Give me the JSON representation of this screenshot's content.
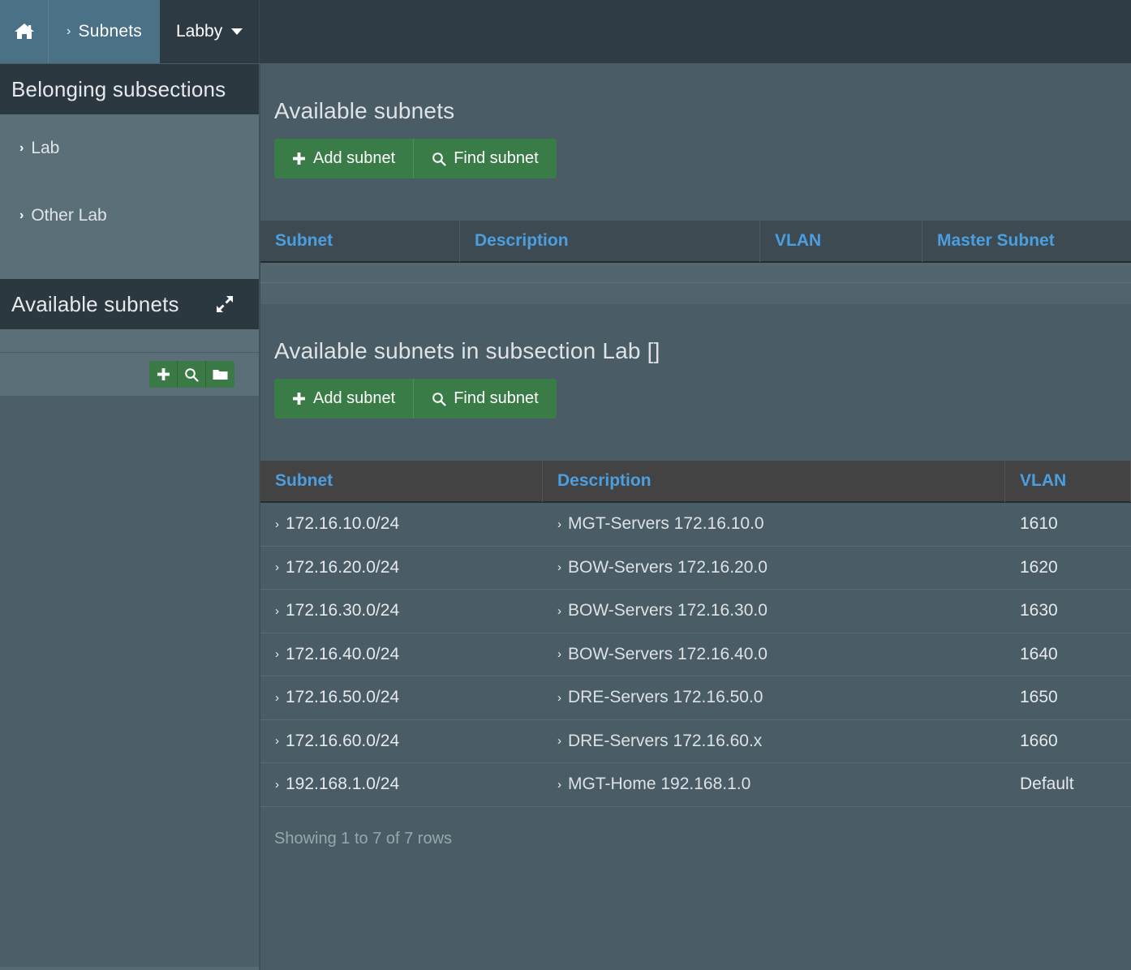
{
  "navbar": {
    "home_icon": "home-icon",
    "breadcrumb": {
      "chevron": "›",
      "label": "Subnets"
    },
    "dropdown": {
      "label": "Labby",
      "caret_icon": "caret-down-icon"
    }
  },
  "sidebar": {
    "subsections_panel": {
      "title": "Belonging subsections",
      "items": [
        {
          "chevron": "›",
          "label": "Lab"
        },
        {
          "chevron": "›",
          "label": "Other Lab"
        }
      ]
    },
    "subnets_panel": {
      "title": "Available subnets",
      "expand_icon": "expand-arrows-icon",
      "toolbar": [
        {
          "icon": "plus-icon",
          "name": "add-subnet-icon-button"
        },
        {
          "icon": "search-icon",
          "name": "find-subnet-icon-button"
        },
        {
          "icon": "folder-icon",
          "name": "folder-icon-button"
        }
      ]
    }
  },
  "main": {
    "section_top": {
      "title": "Available subnets",
      "buttons": [
        {
          "icon": "plus-icon",
          "label": "Add subnet"
        },
        {
          "icon": "search-icon",
          "label": "Find subnet"
        }
      ],
      "table": {
        "columns": [
          "Subnet",
          "Description",
          "VLAN",
          "Master Subnet"
        ],
        "rows": []
      }
    },
    "section_sub": {
      "title": "Available subnets in subsection Lab []",
      "buttons": [
        {
          "icon": "plus-icon",
          "label": "Add subnet"
        },
        {
          "icon": "search-icon",
          "label": "Find subnet"
        }
      ],
      "table": {
        "columns": [
          "Subnet",
          "Description",
          "VLAN"
        ],
        "rows": [
          {
            "chevron": "›",
            "subnet": "172.16.10.0/24",
            "description": "MGT-Servers 172.16.10.0",
            "vlan": "1610"
          },
          {
            "chevron": "›",
            "subnet": "172.16.20.0/24",
            "description": "BOW-Servers 172.16.20.0",
            "vlan": "1620"
          },
          {
            "chevron": "›",
            "subnet": "172.16.30.0/24",
            "description": "BOW-Servers 172.16.30.0",
            "vlan": "1630"
          },
          {
            "chevron": "›",
            "subnet": "172.16.40.0/24",
            "description": "BOW-Servers 172.16.40.0",
            "vlan": "1640"
          },
          {
            "chevron": "›",
            "subnet": "172.16.50.0/24",
            "description": "DRE-Servers 172.16.50.0",
            "vlan": "1650"
          },
          {
            "chevron": "›",
            "subnet": "172.16.60.0/24",
            "description": "DRE-Servers 172.16.60.x",
            "vlan": "1660"
          },
          {
            "chevron": "›",
            "subnet": "192.168.1.0/24",
            "description": "MGT-Home 192.168.1.0",
            "vlan": "Default"
          }
        ]
      },
      "footer": "Showing 1 to 7 of 7 rows"
    }
  },
  "colors": {
    "navbar_bg": "#2f3c45",
    "navbar_active": "#4a7186",
    "sidebar_bg": "#566a74",
    "panel_head_bg": "#2c3840",
    "main_bg": "#4a5c66",
    "green_button": "#3a7c47",
    "table_header_text": "#4b9fe1",
    "table_header_bg": "#434343"
  }
}
